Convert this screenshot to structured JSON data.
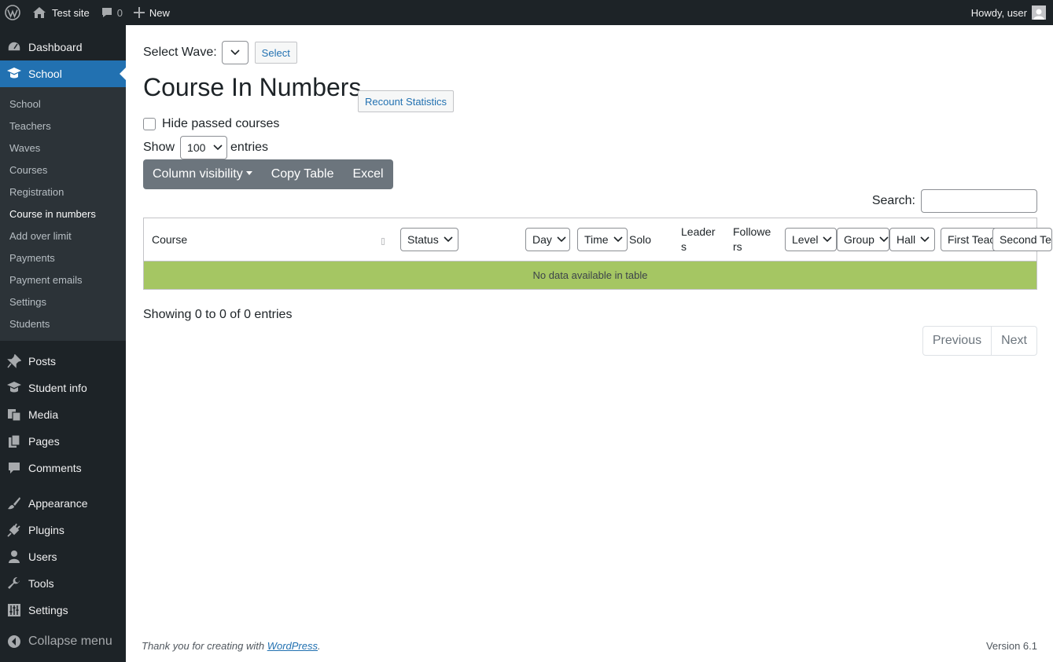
{
  "adminbar": {
    "site_name": "Test site",
    "comments_count": "0",
    "new_label": "New",
    "howdy": "Howdy, user"
  },
  "sidebar": {
    "dashboard": "Dashboard",
    "school": "School",
    "submenu": [
      "School",
      "Teachers",
      "Waves",
      "Courses",
      "Registration",
      "Course in numbers",
      "Add over limit",
      "Payments",
      "Payment emails",
      "Settings",
      "Students"
    ],
    "items": [
      "Posts",
      "Student info",
      "Media",
      "Pages",
      "Comments"
    ],
    "items2": [
      "Appearance",
      "Plugins",
      "Users",
      "Tools",
      "Settings"
    ],
    "collapse": "Collapse menu"
  },
  "main": {
    "wave_label": "Select Wave:",
    "select_button": "Select",
    "title": "Course In Numbers",
    "recount_button": "Recount Statistics",
    "hide_passed": "Hide passed courses",
    "show_label": "Show",
    "entries_value": "100",
    "entries_label": "entries",
    "column_visibility": "Column visibility",
    "copy_table": "Copy Table",
    "excel": "Excel",
    "search_label": "Search:",
    "columns": {
      "course": "Course",
      "status": "Status",
      "day": "Day",
      "time": "Time",
      "solo": "Solo",
      "leaders": "Leader s",
      "followers": "Followe rs",
      "level": "Level",
      "group": "Group",
      "hall": "Hall",
      "first_teacher": "First Teacher",
      "second_teacher": "Second Teacher"
    },
    "empty_message": "No data available in table",
    "info": "Showing 0 to 0 of 0 entries",
    "previous": "Previous",
    "next": "Next"
  },
  "footer": {
    "thanks_prefix": "Thank you for creating with",
    "wordpress": "WordPress",
    "period": ".",
    "version": "Version 6.1"
  },
  "colors": {
    "admin_dark": "#1d2327",
    "accent": "#2271b1",
    "empty_row": "#a5c663",
    "button_group": "#6c757d"
  }
}
